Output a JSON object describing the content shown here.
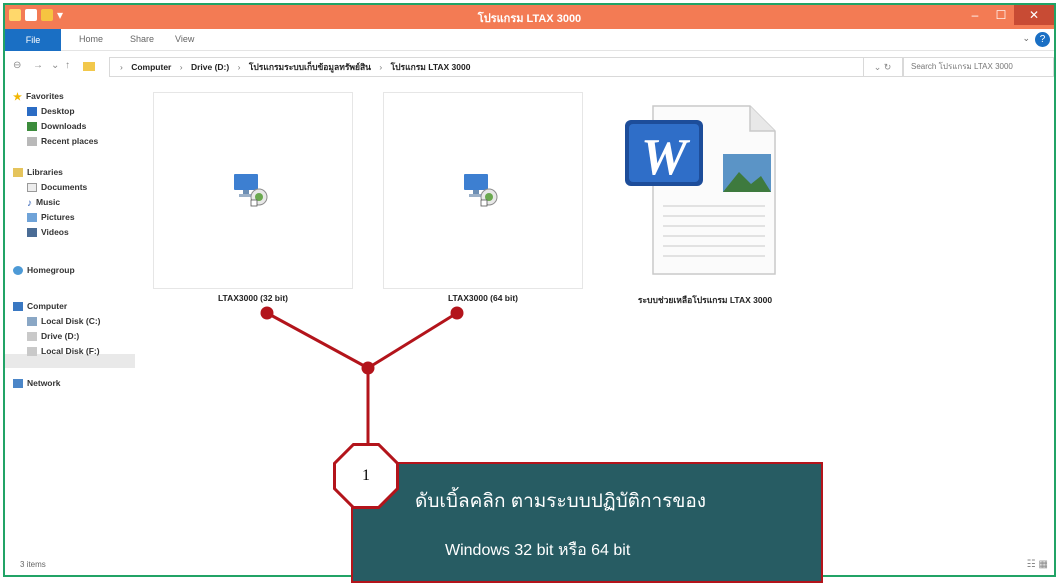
{
  "window": {
    "title": "โปรแกรม LTAX 3000",
    "controls": {
      "minimize": "–",
      "maximize": "☐",
      "close": "✕"
    }
  },
  "ribbon": {
    "file_tab": "File",
    "tabs": [
      "Home",
      "Share",
      "View"
    ]
  },
  "address": {
    "crumbs": [
      "Computer",
      "Drive (D:)",
      "โปรแกรมระบบเก็บข้อมูลทรัพย์สิน",
      "โปรแกรม LTAX 3000"
    ],
    "search_placeholder": "Search โปรแกรม LTAX 3000"
  },
  "sidebar": {
    "favorites": {
      "label": "Favorites",
      "items": [
        "Desktop",
        "Downloads",
        "Recent places"
      ]
    },
    "libraries": {
      "label": "Libraries",
      "items": [
        "Documents",
        "Music",
        "Pictures",
        "Videos"
      ]
    },
    "homegroup": "Homegroup",
    "computer": {
      "label": "Computer",
      "items": [
        "Local Disk (C:)",
        "Drive (D:)",
        "Local Disk (F:)"
      ]
    },
    "network": "Network"
  },
  "files": [
    {
      "name": "LTAX3000 (32 bit)",
      "icon": "shortcut-app-icon"
    },
    {
      "name": "LTAX3000 (64 bit)",
      "icon": "shortcut-app-icon"
    },
    {
      "name": "ระบบช่วยเหลือโปรแกรม LTAX 3000",
      "icon": "word-document-icon"
    }
  ],
  "status": {
    "item_count": "3 items"
  },
  "annotation": {
    "step_number": "1",
    "line1": "ดับเบิ้ลคลิก ตามระบบปฏิบัติการของ",
    "line2": "Windows 32 bit หรือ 64 bit"
  },
  "colors": {
    "title_bar": "#f37b54",
    "file_tab": "#1a6fc4",
    "window_border": "#21a366",
    "callout_bg": "#275c63",
    "callout_border": "#b3141b",
    "connector": "#b3141b"
  }
}
